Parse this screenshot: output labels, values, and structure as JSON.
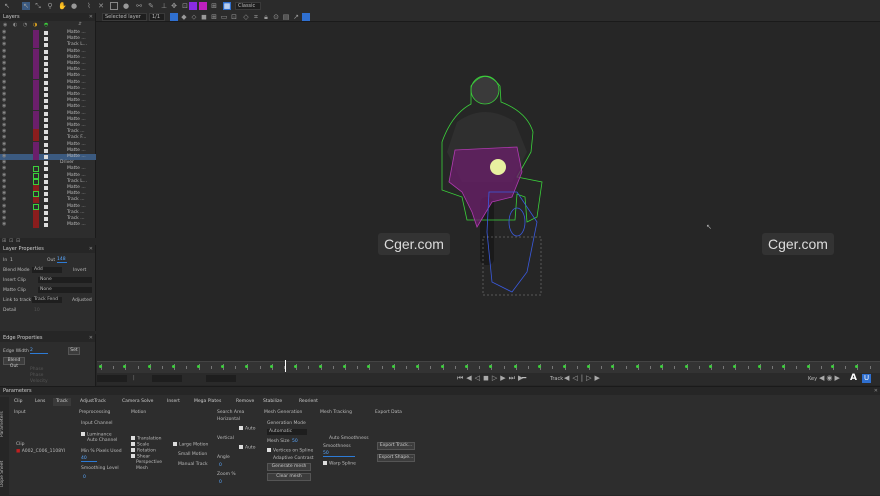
{
  "toolbar": {
    "layer_select": "Selected layer",
    "layer_num": "1/1",
    "mode": "Classic",
    "colors": {
      "purple": "#8a2be2",
      "magenta": "#c020c0",
      "blue": "#2f6fcf"
    }
  },
  "layers_panel": {
    "title": "Layers",
    "rows": [
      {
        "name": "Matte ...",
        "color": "purple"
      },
      {
        "name": "Matte ...",
        "color": "purple"
      },
      {
        "name": "Track L...",
        "color": "purple"
      },
      {
        "name": "Matte ...",
        "color": "purple"
      },
      {
        "name": "Matte ...",
        "color": "purple"
      },
      {
        "name": "Matte ...",
        "color": "purple"
      },
      {
        "name": "Matte ...",
        "color": "purple"
      },
      {
        "name": "Matte ...",
        "color": "purple"
      },
      {
        "name": "Matte ...",
        "color": "purple"
      },
      {
        "name": "Matte ...",
        "color": "purple"
      },
      {
        "name": "Matte ...",
        "color": "purple"
      },
      {
        "name": "Matte ...",
        "color": "purple"
      },
      {
        "name": "Matte ...",
        "color": "purple"
      },
      {
        "name": "Matte ...",
        "color": "purple"
      },
      {
        "name": "Matte ...",
        "color": "purple"
      },
      {
        "name": "Matte ...",
        "color": "purple"
      },
      {
        "name": "Track ...",
        "color": "red"
      },
      {
        "name": "Track F...",
        "color": "red"
      },
      {
        "name": "Matte ...",
        "color": "purple"
      },
      {
        "name": "Matte ...",
        "color": "purple"
      },
      {
        "name": "Matte ...",
        "color": "purple",
        "selected": true
      },
      {
        "name": "Driver",
        "color": "none"
      },
      {
        "name": "Matte ...",
        "color": "green"
      },
      {
        "name": "Matte ...",
        "color": "green"
      },
      {
        "name": "Track L...",
        "color": "green"
      },
      {
        "name": "Matte ...",
        "color": "red"
      },
      {
        "name": "Matte ...",
        "color": "green"
      },
      {
        "name": "Track ...",
        "color": "red"
      },
      {
        "name": "Matte ...",
        "color": "green"
      },
      {
        "name": "Track ...",
        "color": "red"
      },
      {
        "name": "Track ...",
        "color": "red"
      },
      {
        "name": "Matte ...",
        "color": "red"
      }
    ]
  },
  "layer_properties": {
    "title": "Layer Properties",
    "in_label": "In",
    "in_value": "1",
    "out_label": "Out",
    "out_value": "148",
    "blend_label": "Blend Mode",
    "blend_value": "Add",
    "invert": "Invert",
    "insert_clip_label": "Insert Clip",
    "insert_clip_value": "None",
    "matte_clip_label": "Matte Clip",
    "matte_clip_value": "None",
    "link_label": "Link to track",
    "link_value": "Track Fend",
    "adjusted": "Adjusted",
    "detail_label": "Detail",
    "detail_value": "10"
  },
  "edge_properties": {
    "title": "Edge Properties",
    "edge_width_label": "Edge Width",
    "edge_width_value": "2",
    "set_btn": "Set",
    "blend_btn": "Blend Out",
    "grey1": "Phase",
    "grey2": "Phase",
    "grey3": "Velocity"
  },
  "viewer": {
    "watermark_left": "Cger.com",
    "watermark_right": "Cger.com"
  },
  "timeline": {
    "track_label": "Track",
    "key_label": "Key",
    "playhead_fraction": 0.24
  },
  "params": {
    "title": "Parameters",
    "side_tabs": [
      "Parameters",
      "Dope Sheet"
    ],
    "tabs": [
      "Clip",
      "Lens",
      "Track",
      "AdjustTrack",
      "Camera Solve",
      "Insert",
      "Mega Plates",
      "Remove",
      "Stabilize",
      "Reorient"
    ],
    "active_tab": "Track",
    "input": {
      "label": "Input",
      "clip_label": "Clip",
      "clip_value": "A002_C006_1108YI"
    },
    "preprocessing": {
      "label": "Preprocessing",
      "input_channel": "Input Channel",
      "luminance": "Luminance",
      "auto_channel": "Auto Channel",
      "min_pixels": "Min % Pixels Used",
      "min_value": "40",
      "smoothing": "Smoothing Level",
      "smoothing_value": "0"
    },
    "motion": {
      "label": "Motion",
      "translation": "Translation",
      "scale": "Scale",
      "rotation": "Rotation",
      "shear": "Shear",
      "perspective": "Perspective",
      "mesh": "Mesh",
      "large_motion": "Large Motion",
      "small_motion": "Small Motion",
      "manual_track": "Manual Track"
    },
    "search_area": {
      "label": "Search Area",
      "horizontal": "Horizontal",
      "vertical": "Vertical",
      "auto1": "Auto",
      "auto2": "Auto",
      "angle": "Angle",
      "angle_value": "0",
      "zoom": "Zoom %",
      "zoom_value": "0"
    },
    "mesh_gen": {
      "label": "Mesh Generation",
      "mode_label": "Generation Mode",
      "mode_value": "Automatic",
      "mesh_size": "Mesh Size",
      "mesh_size_value": "50",
      "vertices": "Vertices on Spline",
      "adaptive": "Adaptive Contrast",
      "generate": "Generate mesh",
      "clear": "Clear mesh"
    },
    "mesh_tracking": {
      "label": "Mesh Tracking",
      "auto_smooth": "Auto Smoothness",
      "smoothness": "Smoothness",
      "smoothness_value": "50",
      "warp_spline": "Warp Spline"
    },
    "export": {
      "label": "Export Data",
      "export_track": "Export Track...",
      "export_shape": "Export Shape..."
    }
  }
}
